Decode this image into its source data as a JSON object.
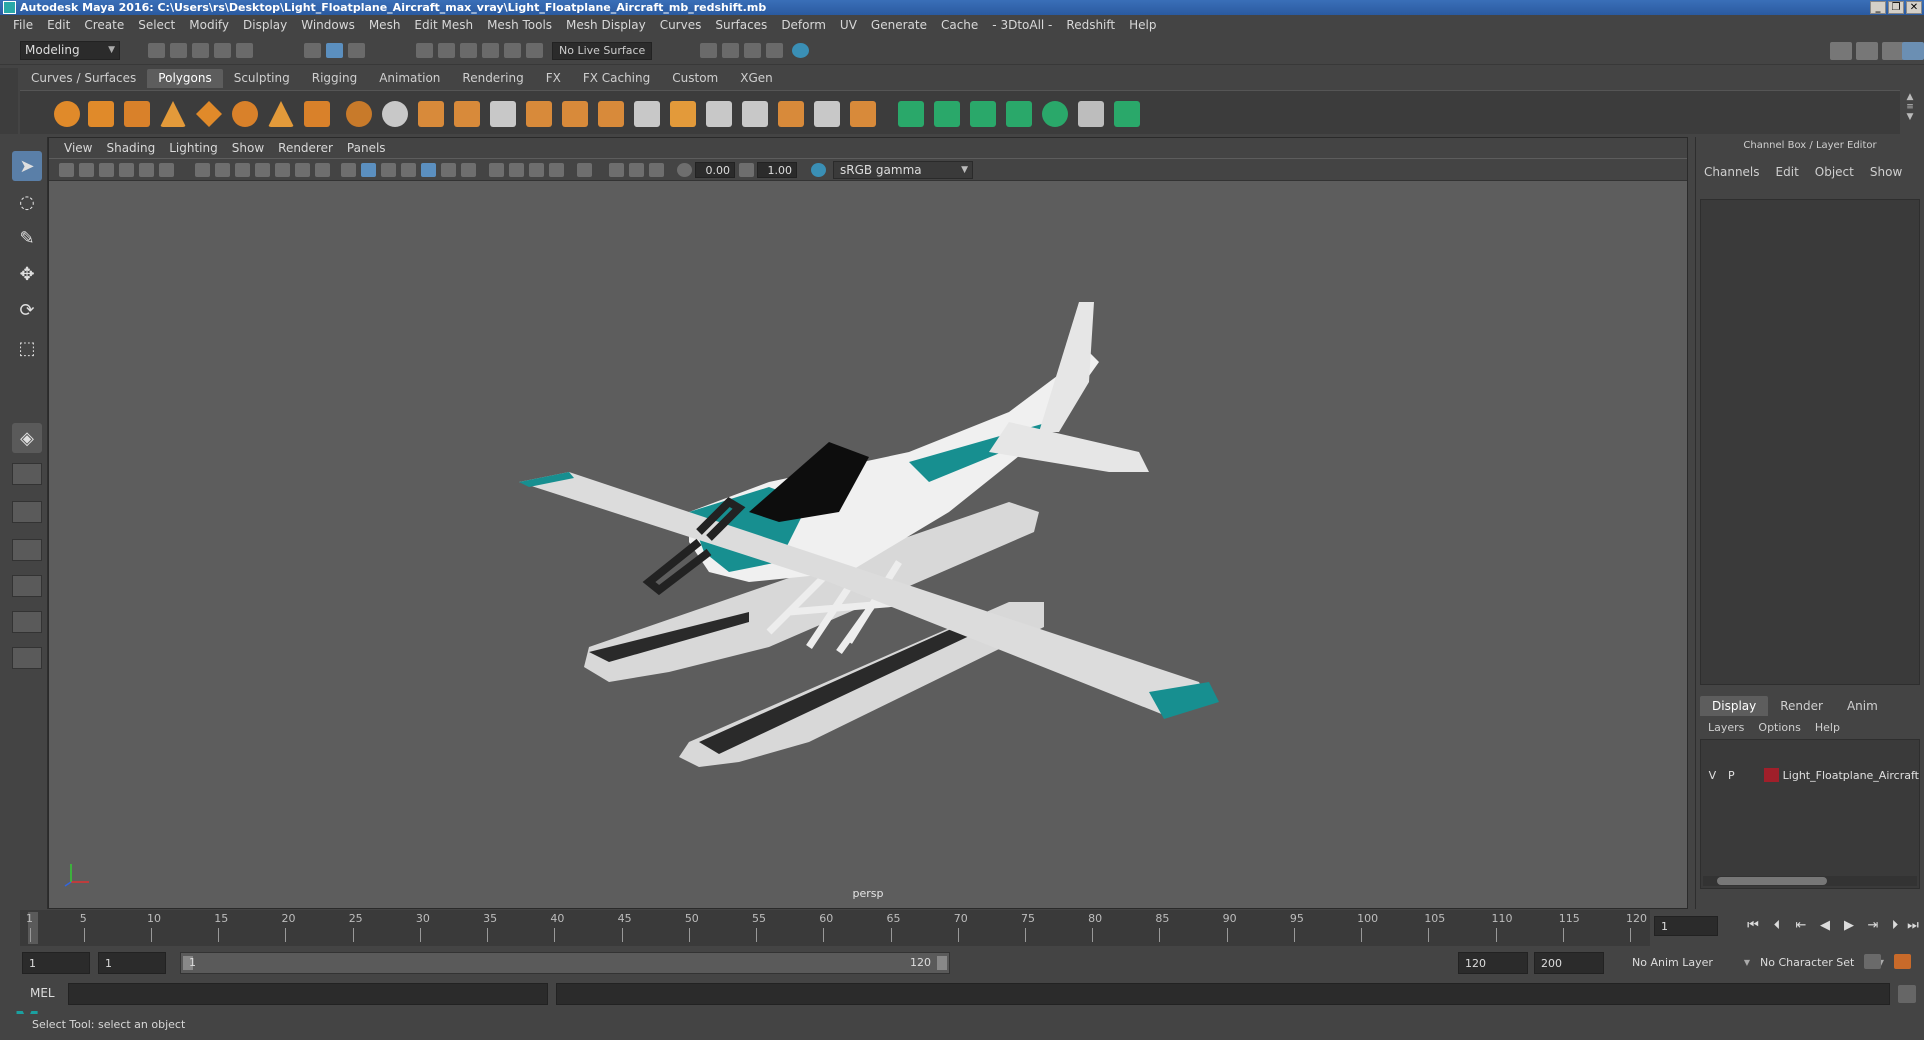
{
  "window": {
    "title": "Autodesk Maya 2016: C:\\Users\\rs\\Desktop\\Light_Floatplane_Aircraft_max_vray\\Light_Floatplane_Aircraft_mb_redshift.mb",
    "controls": [
      "_",
      "❐",
      "✕"
    ]
  },
  "menubar": [
    "File",
    "Edit",
    "Create",
    "Select",
    "Modify",
    "Display",
    "Windows",
    "Mesh",
    "Edit Mesh",
    "Mesh Tools",
    "Mesh Display",
    "Curves",
    "Surfaces",
    "Deform",
    "UV",
    "Generate",
    "Cache",
    "- 3DtoAll -",
    "Redshift",
    "Help"
  ],
  "statusline": {
    "mode": "Modeling",
    "live_surface": "No Live Surface"
  },
  "shelf": {
    "tabs": [
      "Curves / Surfaces",
      "Polygons",
      "Sculpting",
      "Rigging",
      "Animation",
      "Rendering",
      "FX",
      "FX Caching",
      "Custom",
      "XGen"
    ],
    "active_tab": "Polygons"
  },
  "panel": {
    "menus": [
      "View",
      "Shading",
      "Lighting",
      "Show",
      "Renderer",
      "Panels"
    ],
    "exposure": "0.00",
    "gamma": "1.00",
    "color_space": "sRGB gamma",
    "camera": "persp"
  },
  "channel_box": {
    "header": "Channel Box / Layer Editor",
    "menus": [
      "Channels",
      "Edit",
      "Object",
      "Show"
    ]
  },
  "layer_editor": {
    "tabs": [
      "Display",
      "Render",
      "Anim"
    ],
    "active_tab": "Display",
    "menus": [
      "Layers",
      "Options",
      "Help"
    ],
    "layers": [
      {
        "v": "V",
        "p": "P",
        "color": "#a01f2a",
        "name": "Light_Floatplane_Aircraft"
      }
    ]
  },
  "timeline": {
    "ticks": [
      "1",
      "5",
      "10",
      "15",
      "20",
      "25",
      "30",
      "35",
      "40",
      "45",
      "50",
      "55",
      "60",
      "65",
      "70",
      "75",
      "80",
      "85",
      "90",
      "95",
      "100",
      "105",
      "110",
      "115",
      "120"
    ],
    "current_frame": "1"
  },
  "range": {
    "start": "1",
    "playback_start": "1",
    "slider_start": "1",
    "slider_end": "120",
    "playback_end": "120",
    "end": "200",
    "anim_layer": "No Anim Layer",
    "character_set": "No Character Set"
  },
  "command_line": {
    "label": "MEL"
  },
  "help_line": "Select Tool: select an object"
}
